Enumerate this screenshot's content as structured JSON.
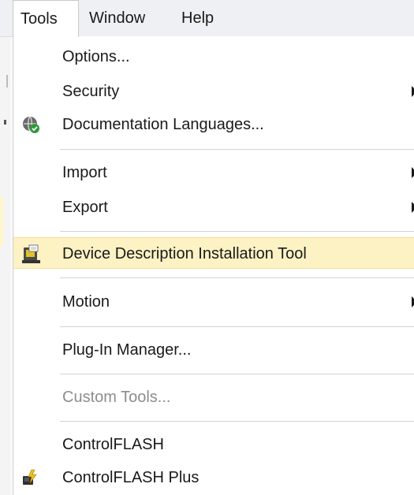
{
  "menubar": {
    "tools": "Tools",
    "window": "Window",
    "help": "Help"
  },
  "menu": {
    "options": "Options...",
    "security": "Security",
    "documentation_languages": "Documentation Languages...",
    "import": "Import",
    "export": "Export",
    "device_description_installation_tool": "Device Description Installation Tool",
    "motion": "Motion",
    "plugin_manager": "Plug-In Manager...",
    "custom_tools": "Custom Tools...",
    "controlflash": "ControlFLASH",
    "controlflash_plus": "ControlFLASH Plus"
  },
  "icons": {
    "documentation_languages": "globe-check-icon",
    "device_description_installation_tool": "device-install-icon",
    "controlflash_plus": "flash-chip-icon"
  },
  "colors": {
    "highlight_background": "#fcf2c4",
    "disabled_text": "#8d8d8d",
    "menubar_background": "#eef0f3"
  }
}
